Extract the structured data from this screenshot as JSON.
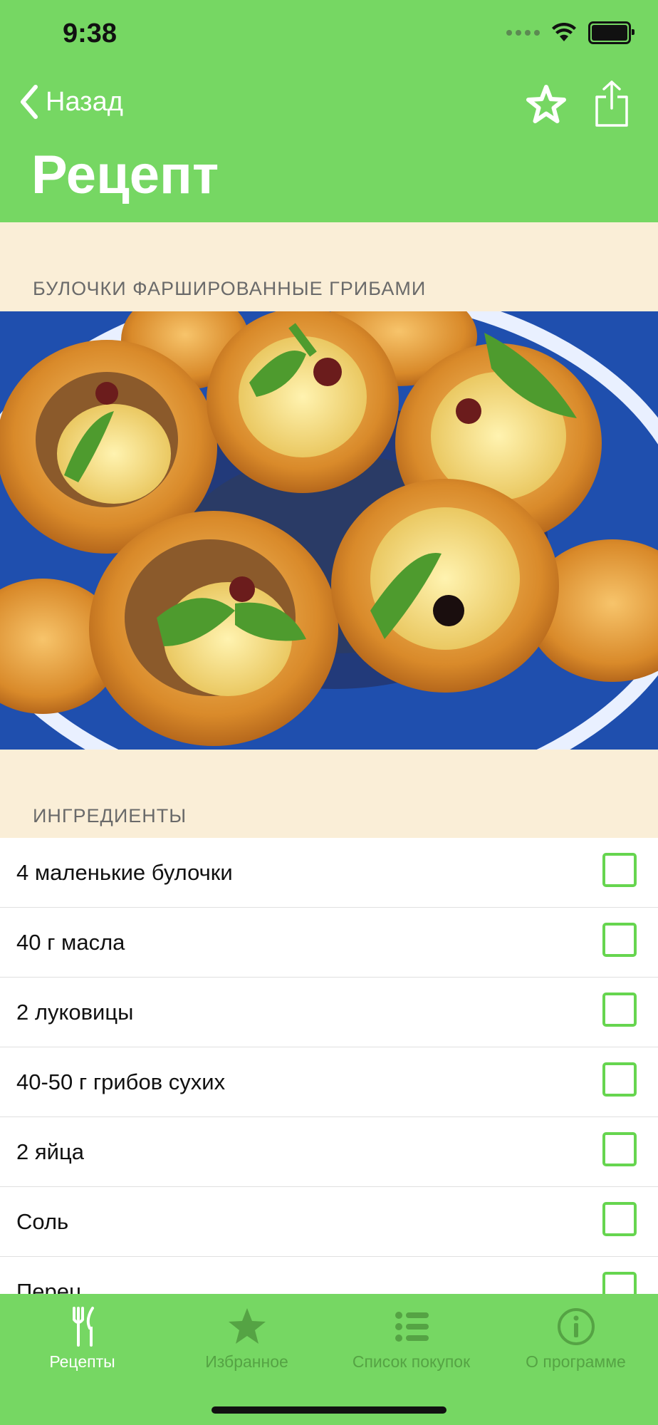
{
  "status_bar": {
    "time": "9:38"
  },
  "nav": {
    "back_label": "Назад",
    "title": "Рецепт"
  },
  "recipe": {
    "name": "БУЛОЧКИ ФАРШИРОВАННЫЕ ГРИБАМИ",
    "ingredients_title": "ИНГРЕДИЕНТЫ",
    "ingredients": [
      "4 маленькие булочки",
      "40 г масла",
      "2 луковицы",
      "40-50 г грибов сухих",
      "2 яйца",
      "Соль",
      "Перец"
    ]
  },
  "tabs": [
    {
      "label": "Рецепты",
      "icon": "fork-knife-icon",
      "active": true
    },
    {
      "label": "Избранное",
      "icon": "star-icon",
      "active": false
    },
    {
      "label": "Список покупок",
      "icon": "list-icon",
      "active": false
    },
    {
      "label": "О программе",
      "icon": "info-icon",
      "active": false
    }
  ],
  "colors": {
    "accent": "#76D763",
    "checkbox": "#66D54F",
    "section_bg": "#FAEED7"
  }
}
